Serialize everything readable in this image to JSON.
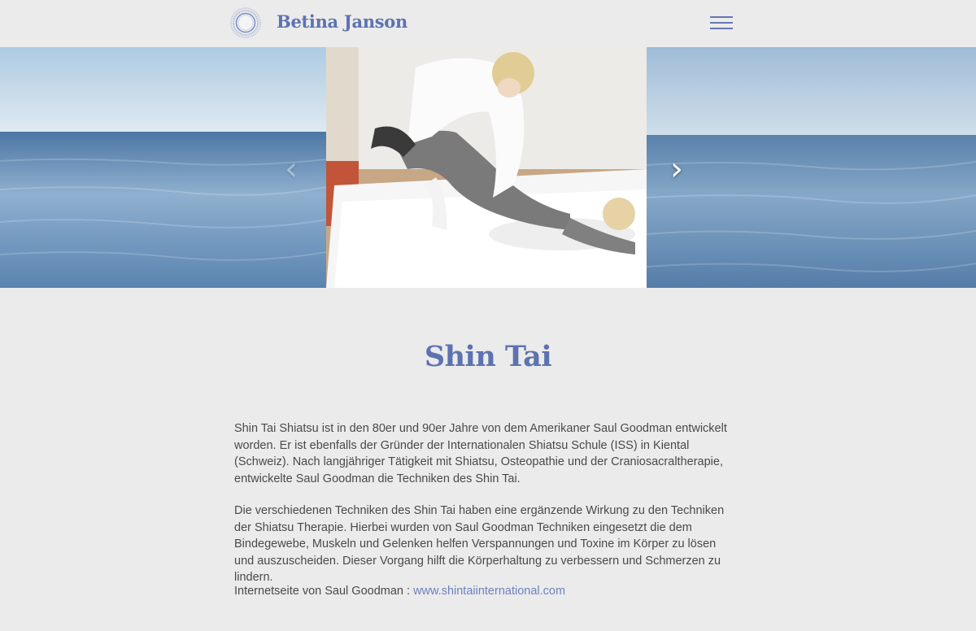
{
  "header": {
    "brand": "Betina Janson",
    "menu_icon": "hamburger-icon",
    "logo_icon": "circle-logo-icon"
  },
  "carousel": {
    "prev_icon": "chevron-left-icon",
    "next_icon": "chevron-right-icon",
    "prev_symbol": "‹",
    "next_symbol": "›",
    "slide_image": "shiatsu-treatment-photo",
    "background_image": "calm-sea-photo"
  },
  "main": {
    "title": "Shin Tai",
    "paragraphs": [
      "Shin Tai Shiatsu ist in den 80er und 90er Jahre von dem Amerikaner Saul Goodman entwickelt worden. Er ist ebenfalls der Gründer der Internationalen Shiatsu Schule (ISS) in Kiental (Schweiz). Nach langjähriger Tätigkeit mit Shiatsu, Osteopathie und der Craniosacraltherapie, entwickelte Saul Goodman die Techniken des Shin Tai.",
      "Die verschiedenen Techniken des Shin Tai haben eine ergänzende Wirkung zu den Techniken der Shiatsu Therapie. Hierbei wurden von Saul Goodman Techniken eingesetzt die dem Bindegewebe, Muskeln und Gelenken helfen Verspannungen und Toxine im Körper zu lösen und auszuscheiden. Dieser Vorgang hilft die Körperhaltung zu verbessern und Schmerzen zu lindern."
    ],
    "website_label": "Internetseite von Saul Goodman : ",
    "website_link": "www.shintaiinternational.com"
  },
  "colors": {
    "accent": "#5d72b0",
    "link": "#6c82bf",
    "background": "#ebebeb"
  }
}
